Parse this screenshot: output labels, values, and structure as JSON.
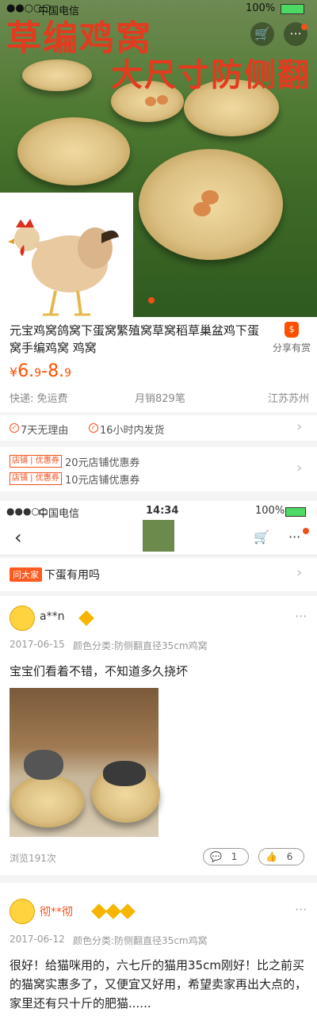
{
  "status_top": {
    "carrier": "中国电信",
    "battery": "100%"
  },
  "hero": {
    "title": "草编鸡窝",
    "subtitle": "大尺寸防侧翻"
  },
  "product": {
    "title": "元宝鸡窝鸽窝下蛋窝繁殖窝草窝稻草巢盆鸡下蛋窝手编鸡窝 鸡窝",
    "share_label": "分享有赏",
    "price_symbol": "¥",
    "price_low_int": "6.",
    "price_low_dec": "9",
    "price_sep": "-",
    "price_high_int": "8.",
    "price_high_dec": "9",
    "shipping": "快递: 免运费",
    "monthly_sales": "月销829笔",
    "location": "江苏苏州"
  },
  "services": {
    "item1": "7天无理由",
    "item2": "16小时内发货"
  },
  "coupons": [
    {
      "tag": "店铺 | 优惠券",
      "text": "20元店铺优惠券"
    },
    {
      "tag": "店铺 | 优惠券",
      "text": "10元店铺优惠券"
    }
  ],
  "status_bar2": {
    "carrier": "中国电信",
    "time": "14:34",
    "battery": "100%"
  },
  "qa": {
    "badge": "问大家",
    "question": "下蛋有用吗"
  },
  "reviews": [
    {
      "user": "a**n",
      "date": "2017-06-15",
      "spec": "颜色分类:防侧翻直径35cm鸡窝",
      "text": "宝宝们看着不错，不知道多久挠坏",
      "views": "浏览191次",
      "comments": "1",
      "likes": "6"
    },
    {
      "user": "彻**彻",
      "date": "2017-06-12",
      "spec": "颜色分类:防侧翻直径35cm鸡窝",
      "text": "很好！给猫咪用的，六七斤的猫用35cm刚好！比之前买的猫窝实惠多了，又便宜又好用，希望卖家再出大点的，家里还有只十斤的肥猫......"
    }
  ],
  "colors": {
    "accent": "#ff5000",
    "hero_text": "#e23b1f"
  }
}
